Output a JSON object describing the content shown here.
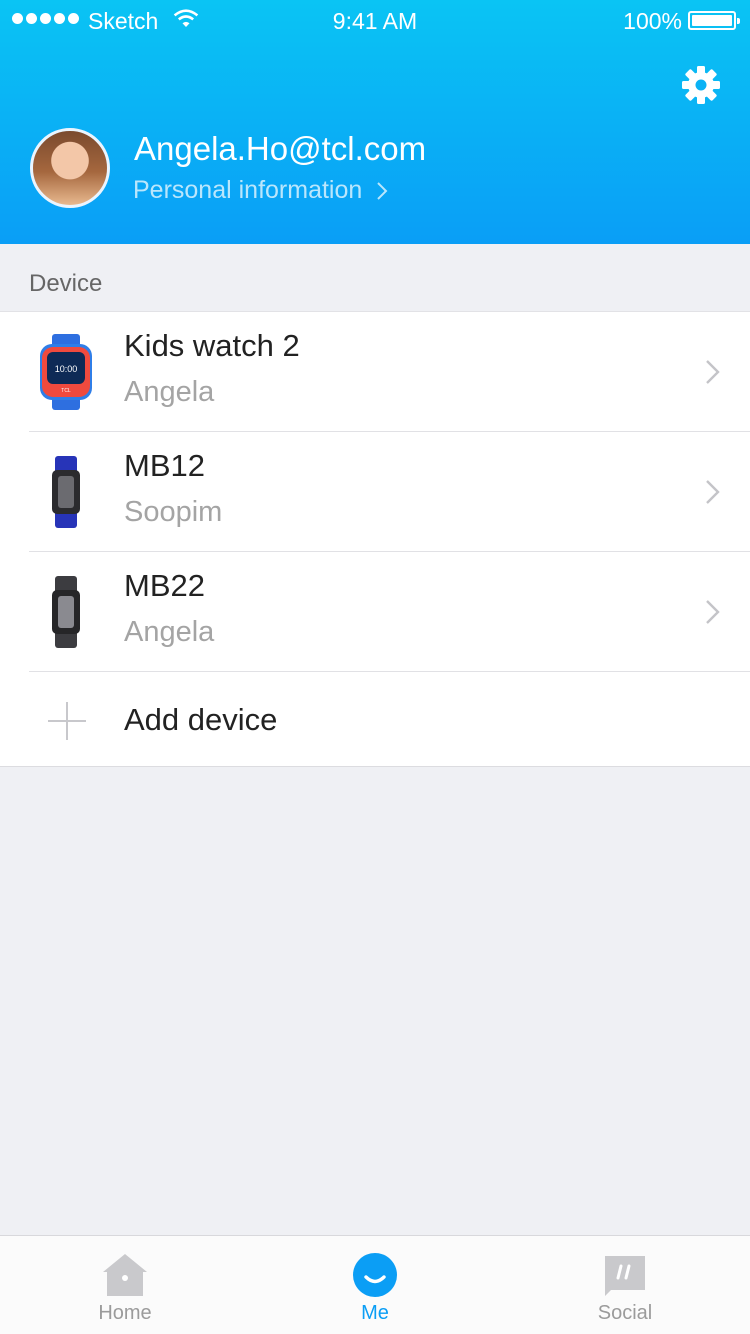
{
  "status_bar": {
    "carrier": "Sketch",
    "time": "9:41 AM",
    "battery_percent": "100%"
  },
  "header": {
    "email": "Angela.Ho@tcl.com",
    "personal_info_link": "Personal information",
    "settings_icon": "gear-icon"
  },
  "devices": {
    "section_title": "Device",
    "items": [
      {
        "name": "Kids watch 2",
        "owner": "Angela",
        "icon": "kids-watch-icon"
      },
      {
        "name": "MB12",
        "owner": "Soopim",
        "icon": "band-blue-icon"
      },
      {
        "name": "MB22",
        "owner": "Angela",
        "icon": "band-grey-icon"
      }
    ],
    "add_label": "Add device"
  },
  "tab_bar": {
    "tabs": [
      {
        "label": "Home",
        "icon": "home-icon"
      },
      {
        "label": "Me",
        "icon": "smile-icon"
      },
      {
        "label": "Social",
        "icon": "quote-bubble-icon"
      }
    ],
    "active": "Me"
  },
  "colors": {
    "header_top": "#0ac4f4",
    "header_bottom": "#0a9ef6",
    "accent": "#0b9ef5",
    "background": "#eff0f4"
  }
}
